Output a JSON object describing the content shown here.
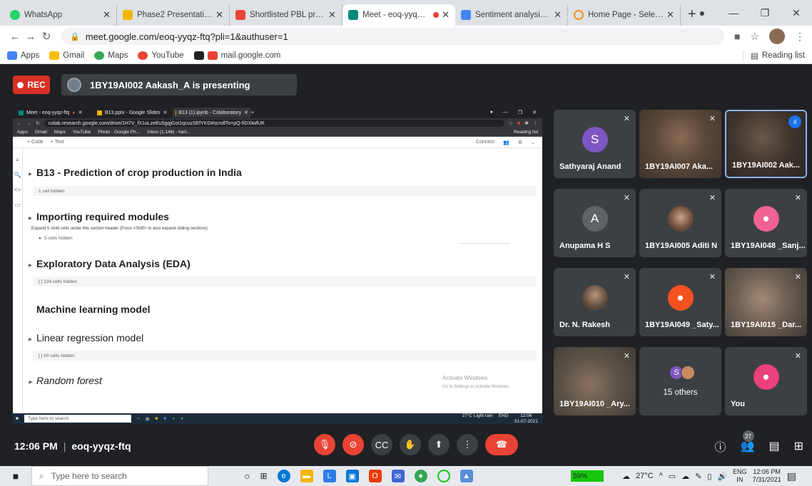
{
  "browser": {
    "tabs": [
      {
        "label": "WhatsApp",
        "color": "#25d366"
      },
      {
        "label": "Phase2 Presentation Grp 10",
        "color": "#f4b400"
      },
      {
        "label": "Shortlisted PBL projects - 1",
        "color": "#ea4335"
      },
      {
        "label": "Meet - eoq-yyqz-ftq",
        "color": "#00897b",
        "active": true
      },
      {
        "label": "Sentiment analysis - Google",
        "color": "#4285f4"
      },
      {
        "label": "Home Page - Select or crea",
        "color": "#f6921e"
      }
    ],
    "url": "meet.google.com/eoq-yyqz-ftq?pli=1&authuser=1",
    "bookmarks": [
      "Apps",
      "Gmail",
      "Maps",
      "YouTube",
      "mail.google.com"
    ],
    "reading_list": "Reading list"
  },
  "meet": {
    "rec_label": "REC",
    "presenting": "1BY19AI002 Aakash_A is presenting",
    "time": "12:06 PM",
    "meeting_code": "eoq-yyqz-ftq",
    "people_count": "27",
    "participants": [
      {
        "name": "Sathyaraj Anand",
        "initial": "S",
        "color": "#7e57c2"
      },
      {
        "name": "1BY19AI007 Aka...",
        "video": "#6d5a4a"
      },
      {
        "name": "1BY19AI002 Aak...",
        "video": "#4a4038"
      },
      {
        "name": "Anupama H S",
        "initial": "A",
        "color": "#5f6368"
      },
      {
        "name": "1BY19AI005 Aditi N",
        "video": "#5d4a46"
      },
      {
        "name": "1BY19AI048 _Sanj...",
        "color": "#f06292"
      },
      {
        "name": "Dr. N. Rakesh",
        "video": "#6b5e52"
      },
      {
        "name": "1BY19AI049 _Saty...",
        "color": "#f4511e"
      },
      {
        "name": "1BY19AI015 _Dar...",
        "video": "#7a6d62"
      },
      {
        "name": "1BY19AI010 _Ary...",
        "video": "#5e5548"
      },
      {
        "name": "15 others",
        "initial": "S"
      },
      {
        "name": "You",
        "color": "#ec407a"
      }
    ]
  },
  "shared": {
    "tabs": [
      "Meet - eoq-yyqz-ftq",
      "B13.pptx - Google Slides",
      "B13 (1).ipynb - Colaboratory"
    ],
    "url": "colab.research.google.com/drive/1H7V_fX1oLzeEu5gqjGot1qcuzSEfYKD#scrollTo=pQ-fiDXtwfUK",
    "bookmarks": [
      "Apps",
      "Gmail",
      "Maps",
      "YouTube",
      "Photo - Google Ph...",
      "Inbox (1,146) - hari..."
    ],
    "reading_list": "Reading list",
    "toolbar": {
      "code": "+ Code",
      "text": "+ Text",
      "connect": "Connect"
    },
    "sections": [
      {
        "title": "B13 - Prediction of crop production in India",
        "hidden": "1 cell hidden"
      },
      {
        "title": "Importing required modules",
        "hidden": "5 cells hidden"
      },
      {
        "title": "Exploratory Data Analysis (EDA)",
        "hidden": "[ ]  134 cells hidden"
      },
      {
        "title": "Machine learning model"
      },
      {
        "title": "Linear regression model",
        "hidden": "[ ]  60 cells hidden"
      },
      {
        "title": "Random forest"
      }
    ],
    "tooltip": "Expand 5 child cells under this section header (Press <Shift> to also expand sibling sections)",
    "activate_title": "Activate Windows",
    "activate_sub": "Go to Settings to activate Windows.",
    "taskbar_search": "Type here to search",
    "weather": "27°C  Light rain",
    "lang": "ENG",
    "time": "12:06",
    "date": "31-07-2021"
  },
  "taskbar": {
    "search": "Type here to search",
    "battery": "59%",
    "weather": "27°C",
    "lang": "ENG",
    "region": "IN",
    "time": "12:06 PM",
    "date": "7/31/2021"
  }
}
